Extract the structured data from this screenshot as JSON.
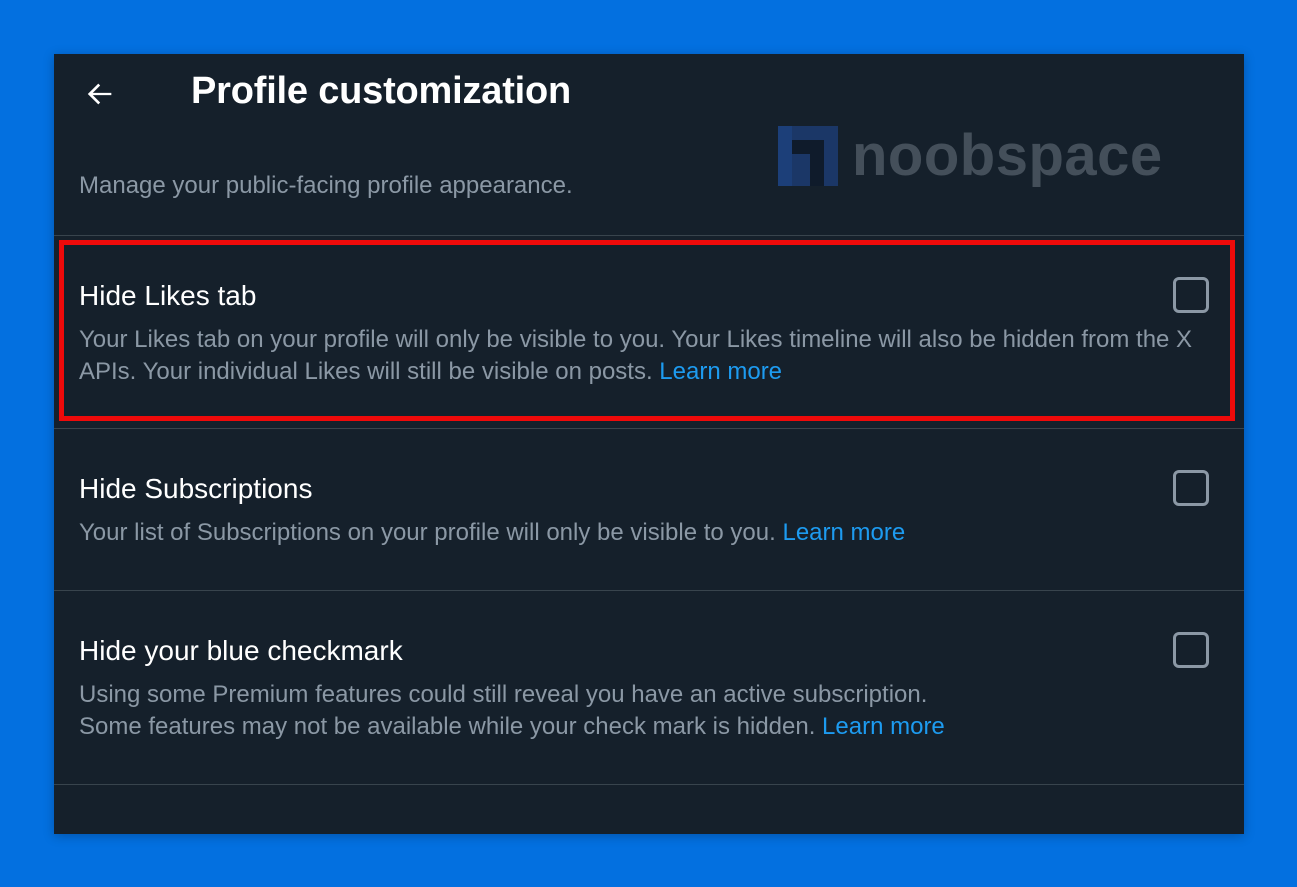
{
  "header": {
    "title": "Profile customization",
    "back_icon": "arrow-left-icon"
  },
  "subtitle": "Manage your public-facing profile appearance.",
  "watermark": {
    "text": "noobspace",
    "logo_icon": "noobspace-logo-icon"
  },
  "settings": [
    {
      "title": "Hide Likes tab",
      "description": "Your Likes tab on your profile will only be visible to you. Your Likes timeline will also be hidden from the X APIs. Your individual Likes will still be visible on posts.",
      "link": "Learn more",
      "checked": false
    },
    {
      "title": "Hide Subscriptions",
      "description": "Your list of Subscriptions on your profile will only be visible to you.",
      "link": "Learn more",
      "checked": false
    },
    {
      "title": "Hide your blue checkmark",
      "description_line1": "Using some Premium features could still reveal you have an active subscription.",
      "description_line2": "Some features may not be available while your check mark is hidden.",
      "link": "Learn more",
      "checked": false
    }
  ],
  "colors": {
    "page_background": "#0370e0",
    "panel_background": "#15202b",
    "link": "#1d9bf0",
    "highlight": "#ee0a0a",
    "secondary_text": "#8b98a5"
  }
}
